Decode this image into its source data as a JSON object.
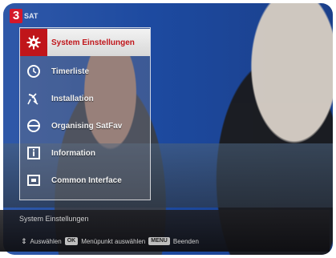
{
  "channel": {
    "logo_number": "3",
    "logo_text": "SAT"
  },
  "menu": {
    "items": [
      {
        "label": "System Einstellungen",
        "icon": "gear-icon",
        "selected": true
      },
      {
        "label": "Timerliste",
        "icon": "clock-icon",
        "selected": false
      },
      {
        "label": "Installation",
        "icon": "satellite-dish-icon",
        "selected": false
      },
      {
        "label": "Organising SatFav",
        "icon": "no-sign-icon",
        "selected": false
      },
      {
        "label": "Information",
        "icon": "info-icon",
        "selected": false
      },
      {
        "label": "Common Interface",
        "icon": "ci-slot-icon",
        "selected": false
      }
    ]
  },
  "status": {
    "title": "System Einstellungen",
    "hints": [
      {
        "key": "",
        "label": "Auswählen"
      },
      {
        "key": "OK",
        "label": "Menüpunkt auswählen"
      },
      {
        "key": "MENU",
        "label": "Beenden"
      }
    ]
  },
  "colors": {
    "accent": "#c0151a",
    "menu_border": "#ffffff"
  }
}
